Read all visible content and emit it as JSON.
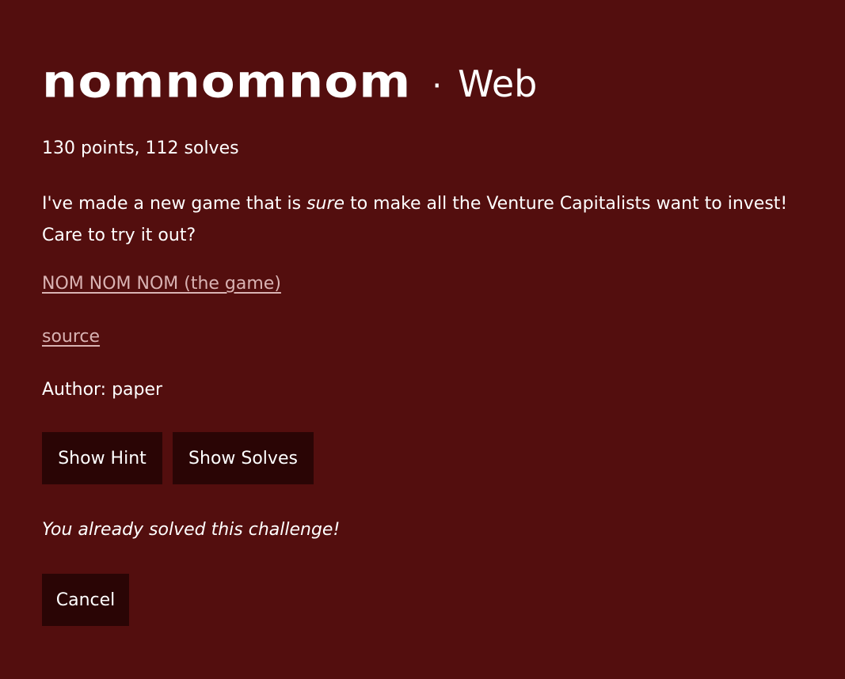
{
  "challenge": {
    "name": "nomnomnom",
    "separator": "·",
    "category": "Web",
    "meta": "130 points, 112 solves",
    "description": {
      "before": "I've made a new game that is ",
      "emphasis": "sure",
      "after": " to make all the Venture Capitalists want to invest! Care to try it out?"
    },
    "links": {
      "game": "NOM NOM NOM (the game)",
      "source": "source"
    },
    "author": "Author: paper",
    "solved_message": "You already solved this challenge!"
  },
  "buttons": {
    "hint": "Show Hint",
    "solves": "Show Solves",
    "cancel": "Cancel"
  },
  "colors": {
    "background": "#530e0e",
    "button_bg": "#2a0505",
    "link": "#d9b3b3",
    "text": "#ffffff"
  }
}
